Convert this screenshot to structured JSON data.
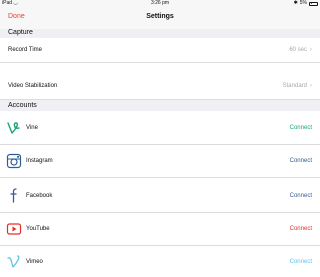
{
  "status_bar": {
    "device": "iPad",
    "time": "3:26 pm",
    "battery": "5%"
  },
  "nav": {
    "done_label": "Done",
    "title": "Settings"
  },
  "capture": {
    "header": "Capture",
    "rows": [
      {
        "label": "Record Time",
        "value": "60 sec"
      },
      {
        "label": "Video Stabilization",
        "value": "Standard"
      }
    ]
  },
  "accounts": {
    "header": "Accounts",
    "items": [
      {
        "name": "Vine",
        "action": "Connect",
        "icon": "vine-icon",
        "color": "#1aa37b"
      },
      {
        "name": "Instagram",
        "action": "Connect",
        "icon": "instagram-icon",
        "color": "#2f5f8f"
      },
      {
        "name": "Facebook",
        "action": "Connect",
        "icon": "facebook-icon",
        "color": "#3b5998"
      },
      {
        "name": "YouTube",
        "action": "Connect",
        "icon": "youtube-icon",
        "color": "#e52d27"
      },
      {
        "name": "Vimeo",
        "action": "Connect",
        "icon": "vimeo-icon",
        "color": "#5fc3e4"
      }
    ]
  },
  "colors": {
    "accent": "#e8442e",
    "separator": "#dcdcdc",
    "group_bg": "#efeff4"
  }
}
